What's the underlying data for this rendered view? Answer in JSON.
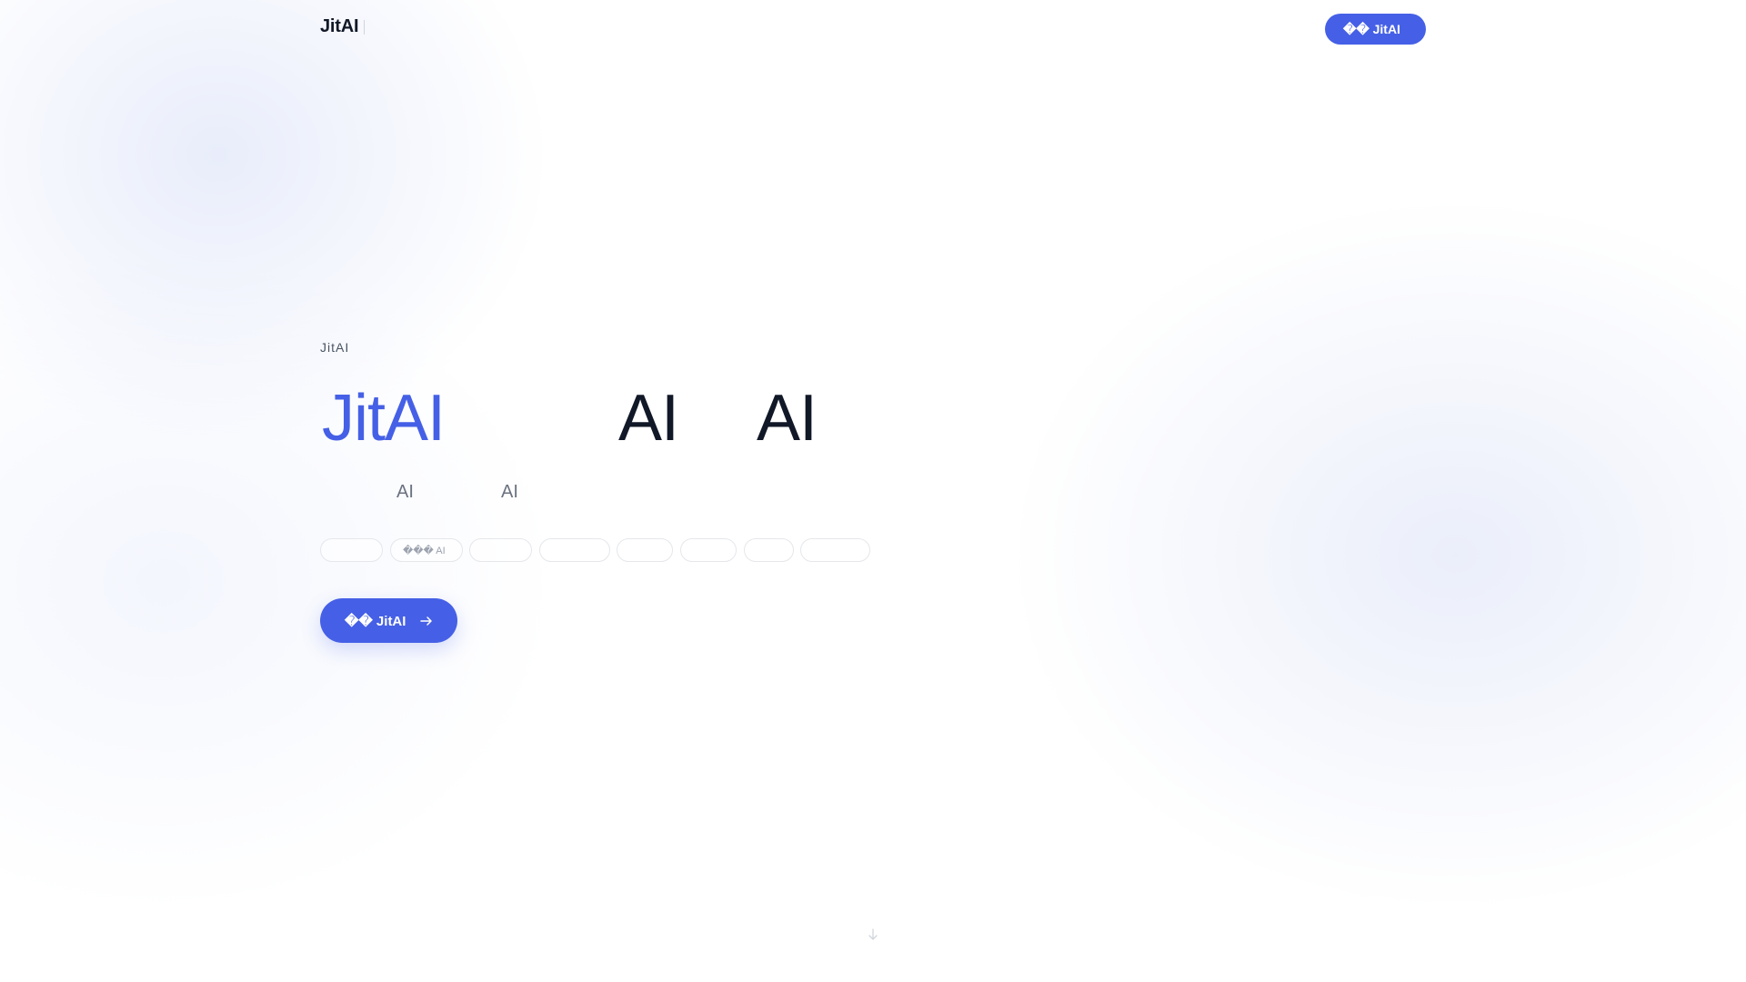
{
  "header": {
    "brand": "JitAI",
    "cta_label": "�� JitAI"
  },
  "hero": {
    "eyebrow": "JitAI",
    "headline": {
      "brand": "JitAI",
      "ai_1": "AI",
      "ai_2": "AI"
    },
    "subline": {
      "ai_1": "AI",
      "ai_2": "AI"
    },
    "tags": [
      "",
      "��� AI",
      "",
      "",
      "",
      "",
      "",
      ""
    ],
    "cta_label": "�� JitAI"
  },
  "icons": {
    "cta_arrow": "arrow-right-icon",
    "scroll_hint": "arrow-down-icon"
  },
  "colors": {
    "accent": "#4560e6",
    "heading": "#111827",
    "muted": "#6b7280",
    "tag_border": "#e5e7eb"
  }
}
